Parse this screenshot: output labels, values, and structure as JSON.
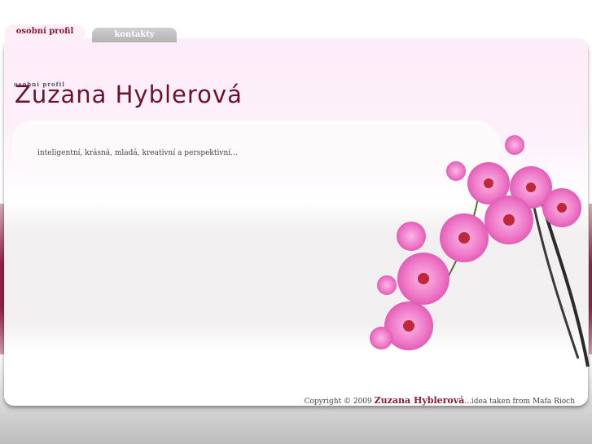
{
  "tabs": [
    {
      "label": "osobní profil",
      "active": true
    },
    {
      "label": "kontakty",
      "active": false
    }
  ],
  "header": {
    "small_label": "osobní profil",
    "title": "Zuzana Hyblerová"
  },
  "tagline": "inteligentní, krásná, mladá, kreativní a perspektivní...",
  "footer": {
    "copyright": "Copyright © 2009",
    "name": "Zuzana Hyblerová",
    "credit": "...idea taken from Mafa Rioch"
  },
  "colors": {
    "brand": "#8b1a33",
    "accent_pink": "#e060b0",
    "tab_inactive": "#bdbdbd"
  },
  "image": {
    "name": "orchid-flowers-image"
  }
}
